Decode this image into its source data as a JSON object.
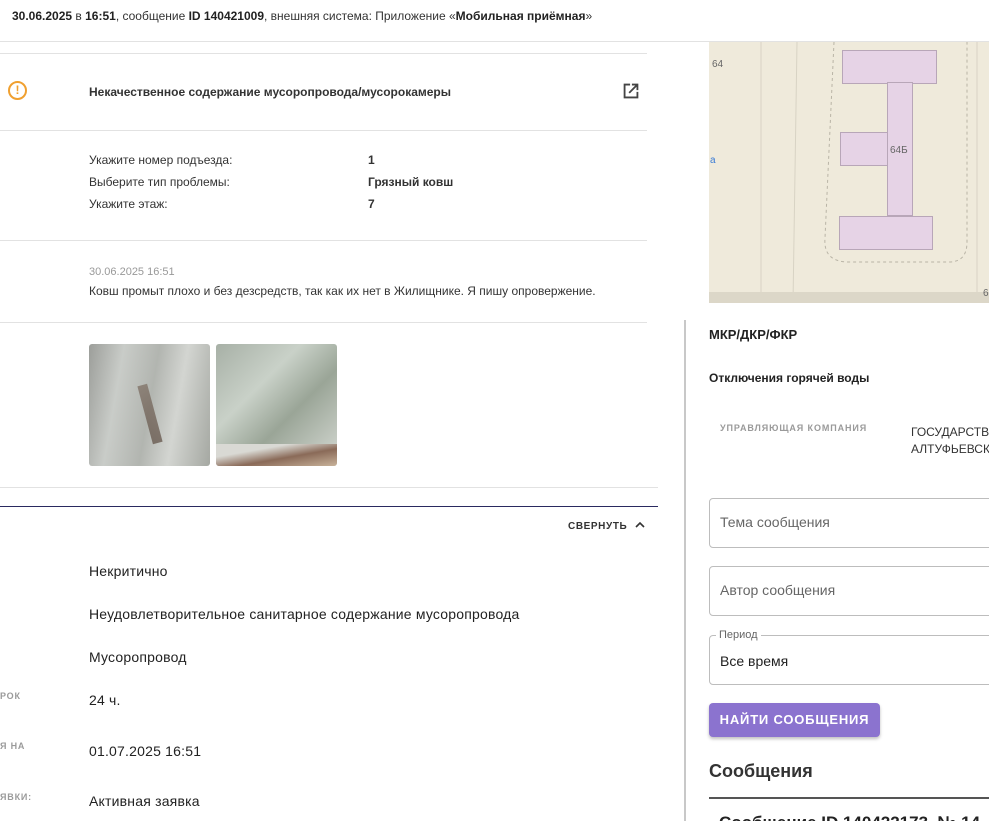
{
  "header": {
    "date": "30.06.2025",
    "in": " в ",
    "time": "16:51",
    "message_prefix": ", сообщение ",
    "message_id": "ID 140421009",
    "system_prefix": ", внешняя система: Приложение «",
    "system_name": "Мобильная приёмная",
    "system_suffix": "»"
  },
  "issue": {
    "title": "Некачественное содержание мусоропровода/мусорокамеры"
  },
  "fields": [
    {
      "label": "Укажите номер подъезда:",
      "value": "1"
    },
    {
      "label": "Выберите тип проблемы:",
      "value": "Грязный ковш"
    },
    {
      "label": "Укажите этаж:",
      "value": "7"
    }
  ],
  "comment": {
    "date": "30.06.2025 16:51",
    "text": "Ковш промыт плохо и без дезсредств, так как их нет в Жилищнике. Я пишу опровержение."
  },
  "collapse_label": "СВЕРНУТЬ",
  "details": {
    "criticality": "Некритично",
    "category": "Неудовлетворительное санитарное содержание мусоропровода",
    "object": "Мусоропровод",
    "deadline_label": "РОК",
    "deadline": "24 ч.",
    "due_label": "Я НА",
    "due": "01.07.2025 16:51",
    "status_label": "ЯВКИ:",
    "status": "Активная заявка"
  },
  "map": {
    "label_64": "64",
    "label_64b": "64Б",
    "label_a": "а",
    "label_6": "6"
  },
  "right": {
    "mkr": "МКР/ДКР/ФКР",
    "hot_water": "Отключения горячей воды",
    "mgmt_label": "УПРАВЛЯЮЩАЯ КОМПАНИЯ",
    "mgmt_value_1": "ГОСУДАРСТВ",
    "mgmt_value_2": "АЛТУФЬЕВСК",
    "topic_placeholder": "Тема сообщения",
    "author_placeholder": "Автор сообщения",
    "period_legend": "Период",
    "period_value": "Все время",
    "find_button": "НАЙТИ СООБЩЕНИЯ",
    "messages_heading": "Сообщения",
    "message_item": "Сообщение ID 140422173, № 14"
  },
  "colors": {
    "accent": "#8b73cf",
    "warning": "#f0a030",
    "divider": "#2a2a60"
  }
}
